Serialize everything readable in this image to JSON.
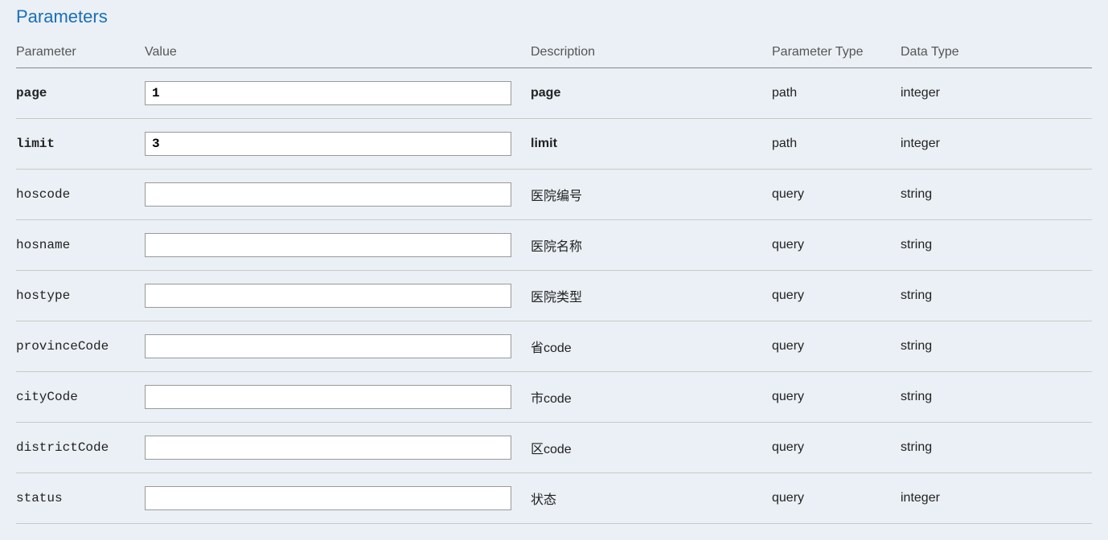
{
  "sectionTitle": "Parameters",
  "headers": {
    "parameter": "Parameter",
    "value": "Value",
    "description": "Description",
    "parameterType": "Parameter Type",
    "dataType": "Data Type"
  },
  "rows": [
    {
      "name": "page",
      "value": "1",
      "description": "page",
      "paramType": "path",
      "dataType": "integer",
      "required": true
    },
    {
      "name": "limit",
      "value": "3",
      "description": "limit",
      "paramType": "path",
      "dataType": "integer",
      "required": true
    },
    {
      "name": "hoscode",
      "value": "",
      "description": "医院编号",
      "paramType": "query",
      "dataType": "string",
      "required": false
    },
    {
      "name": "hosname",
      "value": "",
      "description": "医院名称",
      "paramType": "query",
      "dataType": "string",
      "required": false
    },
    {
      "name": "hostype",
      "value": "",
      "description": "医院类型",
      "paramType": "query",
      "dataType": "string",
      "required": false
    },
    {
      "name": "provinceCode",
      "value": "",
      "description": "省code",
      "paramType": "query",
      "dataType": "string",
      "required": false
    },
    {
      "name": "cityCode",
      "value": "",
      "description": "市code",
      "paramType": "query",
      "dataType": "string",
      "required": false
    },
    {
      "name": "districtCode",
      "value": "",
      "description": "区code",
      "paramType": "query",
      "dataType": "string",
      "required": false
    },
    {
      "name": "status",
      "value": "",
      "description": "状态",
      "paramType": "query",
      "dataType": "integer",
      "required": false
    }
  ]
}
